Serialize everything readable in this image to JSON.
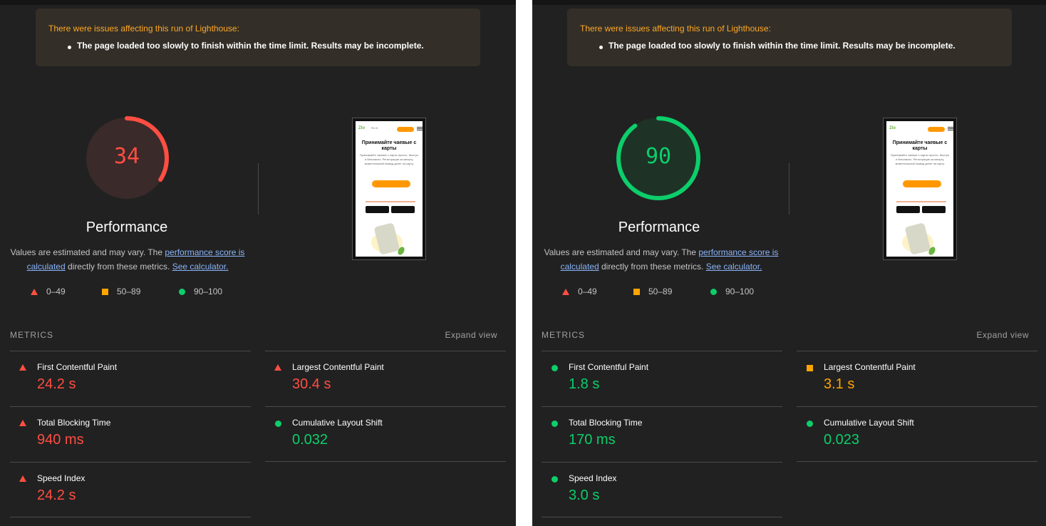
{
  "panels": [
    {
      "warning_title": "There were issues affecting this run of Lighthouse:",
      "warning_item": "The page loaded too slowly to finish within the time limit. Results may be incomplete.",
      "score": "34",
      "score_fraction": 0.34,
      "score_color": "#ff4e42",
      "score_bg": "#3a2a2a",
      "category": "Performance",
      "desc_pre": "Values are estimated and may vary. The ",
      "desc_link1": "performance score is calculated",
      "desc_mid": " directly from these metrics. ",
      "desc_link2": "See calculator.",
      "legend": {
        "fail": "0–49",
        "average": "50–89",
        "pass": "90–100"
      },
      "metrics_heading": "METRICS",
      "expand_label": "Expand view",
      "metrics": [
        {
          "label": "First Contentful Paint",
          "value": "24.2 s",
          "rating": "fail"
        },
        {
          "label": "Largest Contentful Paint",
          "value": "30.4 s",
          "rating": "fail"
        },
        {
          "label": "Total Blocking Time",
          "value": "940 ms",
          "rating": "fail"
        },
        {
          "label": "Cumulative Layout Shift",
          "value": "0.032",
          "rating": "pass"
        },
        {
          "label": "Speed Index",
          "value": "24.2 s",
          "rating": "fail"
        }
      ],
      "screenshot": {
        "logo": "Zlo",
        "headline": "Принимайте чаевые с карты",
        "sub": "Принимайте чаевые с карты просто, быстро и безопасно. Регистрация за минуту, моментальный вывод денег на карту"
      }
    },
    {
      "warning_title": "There were issues affecting this run of Lighthouse:",
      "warning_item": "The page loaded too slowly to finish within the time limit. Results may be incomplete.",
      "score": "90",
      "score_fraction": 0.9,
      "score_color": "#0cce6b",
      "score_bg": "#1e3326",
      "category": "Performance",
      "desc_pre": "Values are estimated and may vary. The ",
      "desc_link1": "performance score is calculated",
      "desc_mid": " directly from these metrics. ",
      "desc_link2": "See calculator.",
      "legend": {
        "fail": "0–49",
        "average": "50–89",
        "pass": "90–100"
      },
      "metrics_heading": "METRICS",
      "expand_label": "Expand view",
      "metrics": [
        {
          "label": "First Contentful Paint",
          "value": "1.8 s",
          "rating": "pass"
        },
        {
          "label": "Largest Contentful Paint",
          "value": "3.1 s",
          "rating": "average"
        },
        {
          "label": "Total Blocking Time",
          "value": "170 ms",
          "rating": "pass"
        },
        {
          "label": "Cumulative Layout Shift",
          "value": "0.023",
          "rating": "pass"
        },
        {
          "label": "Speed Index",
          "value": "3.0 s",
          "rating": "pass"
        }
      ],
      "screenshot": {
        "logo": "Zlo",
        "headline": "Принимайте чаевые с карты",
        "sub": "Принимайте чаевые с карты просто, быстро и безопасно. Регистрация за минуту, моментальный вывод денег на карту"
      }
    }
  ]
}
